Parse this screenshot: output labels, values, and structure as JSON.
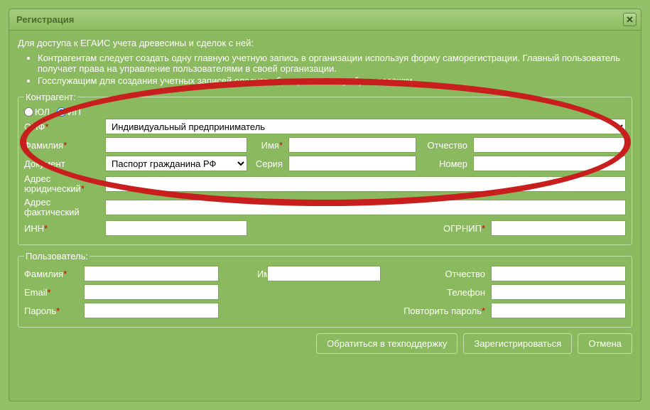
{
  "title": "Регистрация",
  "intro": "Для доступа к ЕГАИС учета древесины и сделок с ней:",
  "bullets": [
    "Контрагентам следует создать одну главную учетную запись в организации используя форму саморегистрации. Главный пользователь получает права на управление пользователями в своей организации.",
    "Госслужащим для создания учетных записей следует обращаться в службу поддержки."
  ],
  "kontragent": {
    "legend": "Контрагент:",
    "radio_yl": "ЮЛ",
    "radio_ip": "ИП",
    "radio_selected": "ip",
    "opf_label": "ОПФ",
    "opf_value": "Индивидуальный предприниматель",
    "lastname_label": "Фамилия",
    "name_label": "Имя",
    "patronymic_label": "Отчество",
    "document_label": "Документ",
    "document_value": "Паспорт гражданина РФ",
    "series_label": "Серия",
    "number_label": "Номер",
    "legal_addr_label": "Адрес юридический",
    "actual_addr_label": "Адрес фактический",
    "inn_label": "ИНН",
    "ogrnip_label": "ОГРНИП"
  },
  "user": {
    "legend": "Пользователь:",
    "lastname_label": "Фамилия",
    "name_label": "Имя",
    "patronymic_label": "Отчество",
    "email_label": "Email",
    "phone_label": "Телефон",
    "password_label": "Пароль",
    "password2_label": "Повторить пароль"
  },
  "buttons": {
    "support": "Обратиться в техподдержку",
    "register": "Зарегистрироваться",
    "cancel": "Отмена"
  }
}
